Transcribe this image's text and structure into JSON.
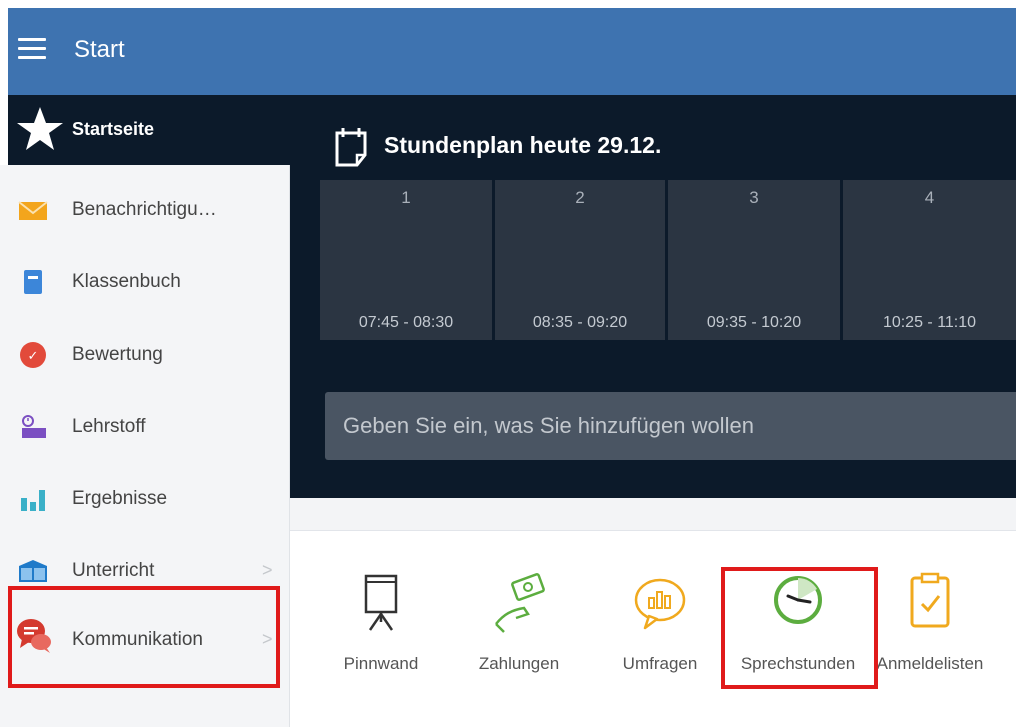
{
  "header": {
    "title": "Start",
    "menu_icon": "hamburger-icon"
  },
  "sidebar": {
    "start": {
      "label": "Startseite",
      "icon": "star-icon"
    },
    "items": [
      {
        "label": "Benachrichtigu…",
        "icon": "envelope-icon"
      },
      {
        "label": "Klassenbuch",
        "icon": "book-icon"
      },
      {
        "label": "Bewertung",
        "icon": "grade-icon"
      },
      {
        "label": "Lehrstoff",
        "icon": "teacher-icon"
      },
      {
        "label": "Ergebnisse",
        "icon": "bar-chart-icon"
      },
      {
        "label": "Unterricht",
        "icon": "open-book-icon",
        "chevron": ">"
      },
      {
        "label": "Kommunikation",
        "icon": "chat-icon",
        "chevron": ">"
      }
    ]
  },
  "timetable": {
    "title": "Stundenplan heute 29.12.",
    "periods": [
      {
        "number": "1",
        "time": "07:45 - 08:30"
      },
      {
        "number": "2",
        "time": "08:35 - 09:20"
      },
      {
        "number": "3",
        "time": "09:35 - 10:20"
      },
      {
        "number": "4",
        "time": "10:25 - 11:10"
      }
    ]
  },
  "add_input": {
    "placeholder": "Geben Sie ein, was Sie hinzufügen wollen"
  },
  "apps": [
    {
      "label": "Pinnwand",
      "icon": "flipchart-icon"
    },
    {
      "label": "Zahlungen",
      "icon": "money-hand-icon"
    },
    {
      "label": "Umfragen",
      "icon": "poll-bubble-icon"
    },
    {
      "label": "Sprechstunden",
      "icon": "clock-icon"
    },
    {
      "label": "Anmeldelisten",
      "icon": "clipboard-check-icon"
    }
  ],
  "colors": {
    "header": "#3e73b0",
    "dark_bg": "#0c1a2a",
    "highlight": "#e01a1a",
    "green": "#5cad3f",
    "orange": "#f0a91e"
  }
}
